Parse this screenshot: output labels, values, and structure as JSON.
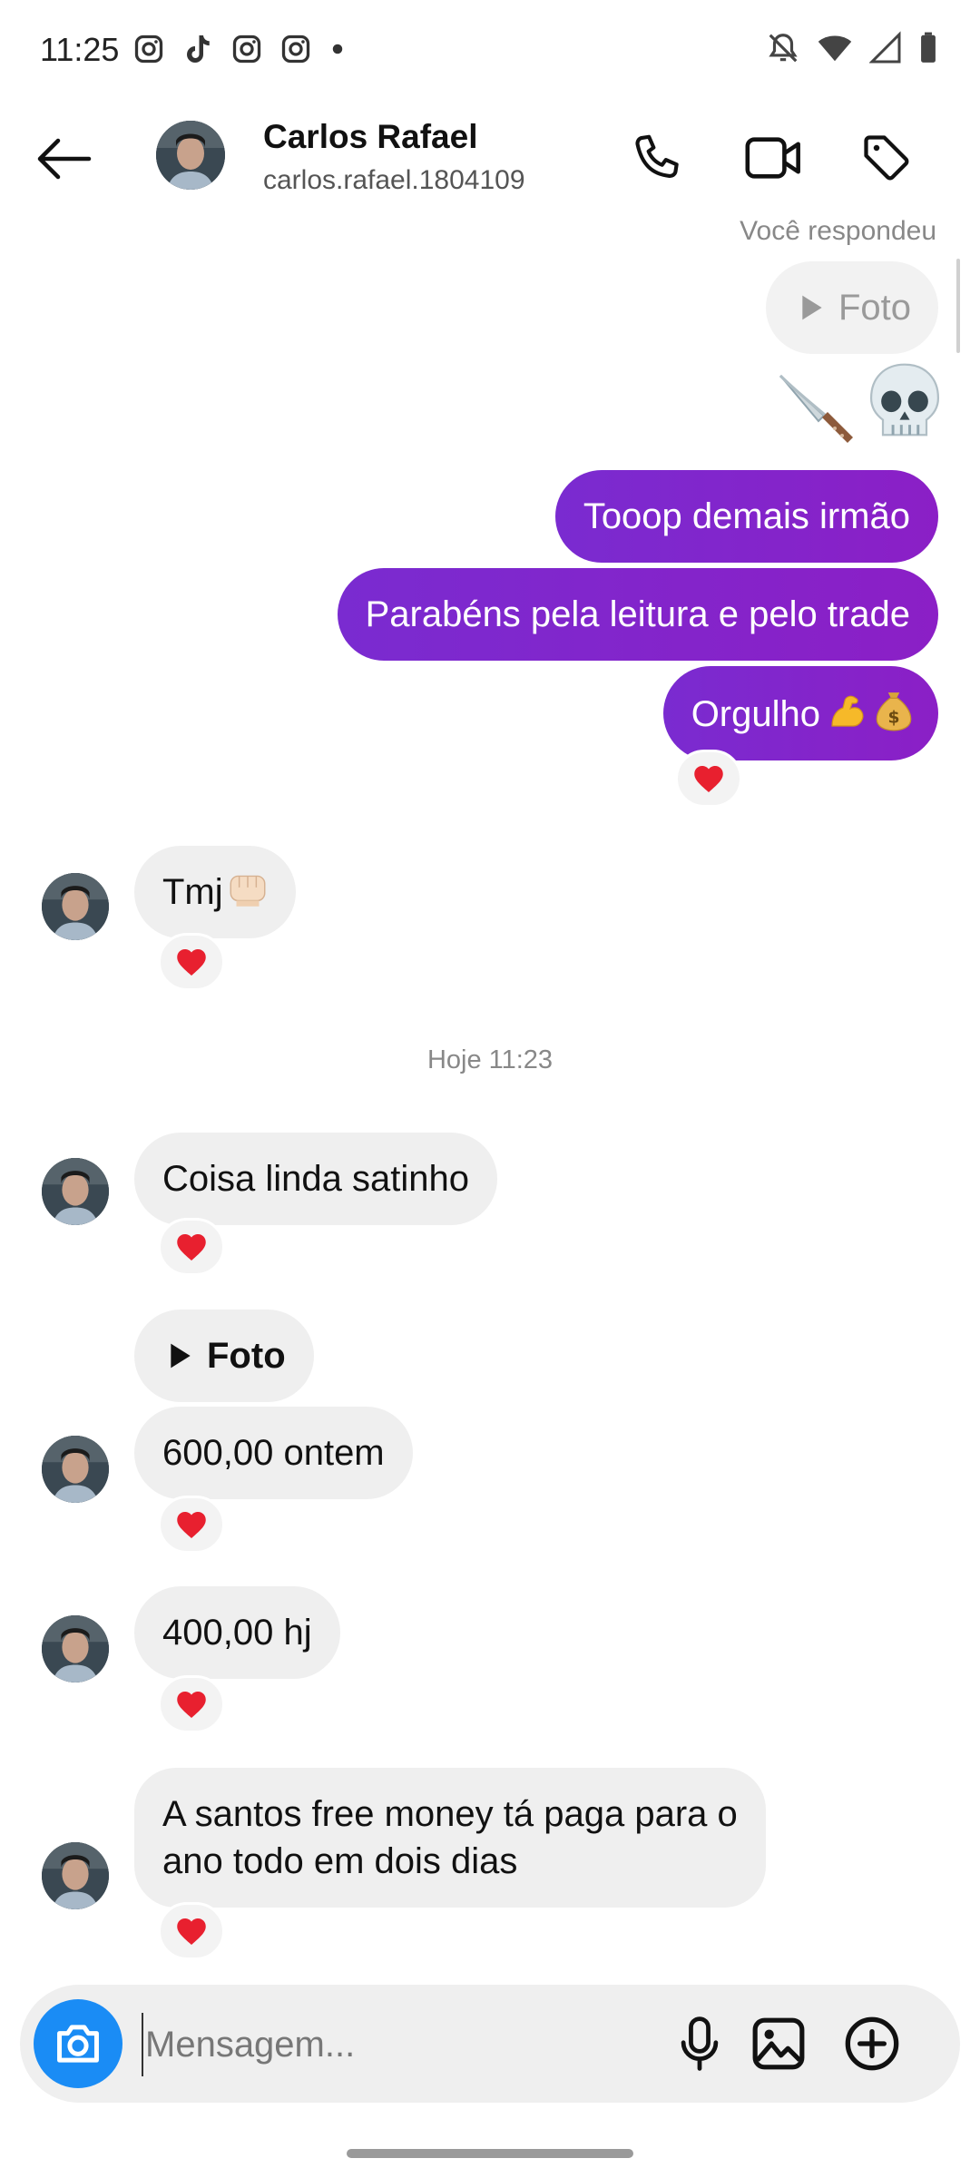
{
  "status_bar": {
    "time": "11:25",
    "left_icons": [
      "instagram-icon",
      "tiktok-icon",
      "instagram-icon",
      "instagram-icon",
      "dot-icon"
    ],
    "right_icons": [
      "mute-bell-icon",
      "wifi-icon",
      "signal-icon",
      "battery-icon"
    ]
  },
  "header": {
    "name": "Carlos Rafael",
    "username": "carlos.rafael.1804109"
  },
  "thread": {
    "replied_label": "Você respondeu",
    "out_photo_label": "Foto",
    "out_messages": [
      "Tooop demais irmão",
      "Parabéns pela leitura e pelo trade",
      "Orgulho"
    ],
    "in_tmj": "Tmj",
    "date_separator": "Hoje 11:23",
    "in_messages": [
      "Coisa linda satinho",
      "600,00 ontem",
      "400,00 hj",
      "A santos free money tá paga para o",
      "ano todo em dois dias"
    ],
    "in_photo_label": "Foto",
    "reaction": "heart"
  },
  "composer": {
    "placeholder": "Mensagem..."
  },
  "colors": {
    "outgoing_bubble": "#8223cc",
    "incoming_bubble": "#efefef",
    "camera_button": "#1a8cf5",
    "heart": "#e8202f"
  }
}
